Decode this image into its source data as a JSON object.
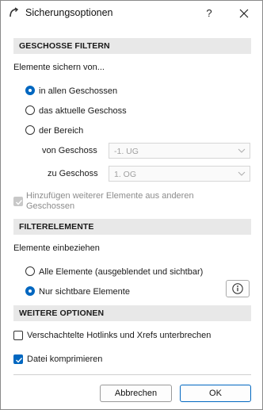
{
  "window": {
    "title": "Sicherungsoptionen",
    "help_label": "?",
    "app_icon": "archicad-logo-icon",
    "close_icon": "close-icon"
  },
  "floors": {
    "header": "GESCHOSSE FILTERN",
    "prompt": "Elemente sichern von...",
    "options": [
      {
        "label": "in allen Geschossen",
        "selected": true
      },
      {
        "label": "das aktuelle Geschoss",
        "selected": false
      },
      {
        "label": "der Bereich",
        "selected": false
      }
    ],
    "from_label": "von Geschoss",
    "from_value": "-1. UG",
    "to_label": "zu Geschoss",
    "to_value": "1. OG",
    "add_others_label": "Hinzufügen weiterer Elemente aus anderen Geschossen",
    "add_others_checked": true,
    "add_others_enabled": false
  },
  "filter": {
    "header": "FILTERELEMENTE",
    "prompt": "Elemente einbeziehen",
    "options": [
      {
        "label": "Alle Elemente (ausgeblendet und sichtbar)",
        "selected": false
      },
      {
        "label": "Nur sichtbare Elemente",
        "selected": true
      }
    ],
    "info_icon": "info-icon"
  },
  "more": {
    "header": "WEITERE OPTIONEN",
    "break_hotlinks_label": "Verschachtelte Hotlinks und Xrefs unterbrechen",
    "break_hotlinks_checked": false,
    "compress_label": "Datei komprimieren",
    "compress_checked": true
  },
  "buttons": {
    "cancel": "Abbrechen",
    "ok": "OK"
  },
  "colors": {
    "accent": "#0067c0",
    "section_bg": "#e8e8e8",
    "disabled_text": "#8c8c8c"
  }
}
